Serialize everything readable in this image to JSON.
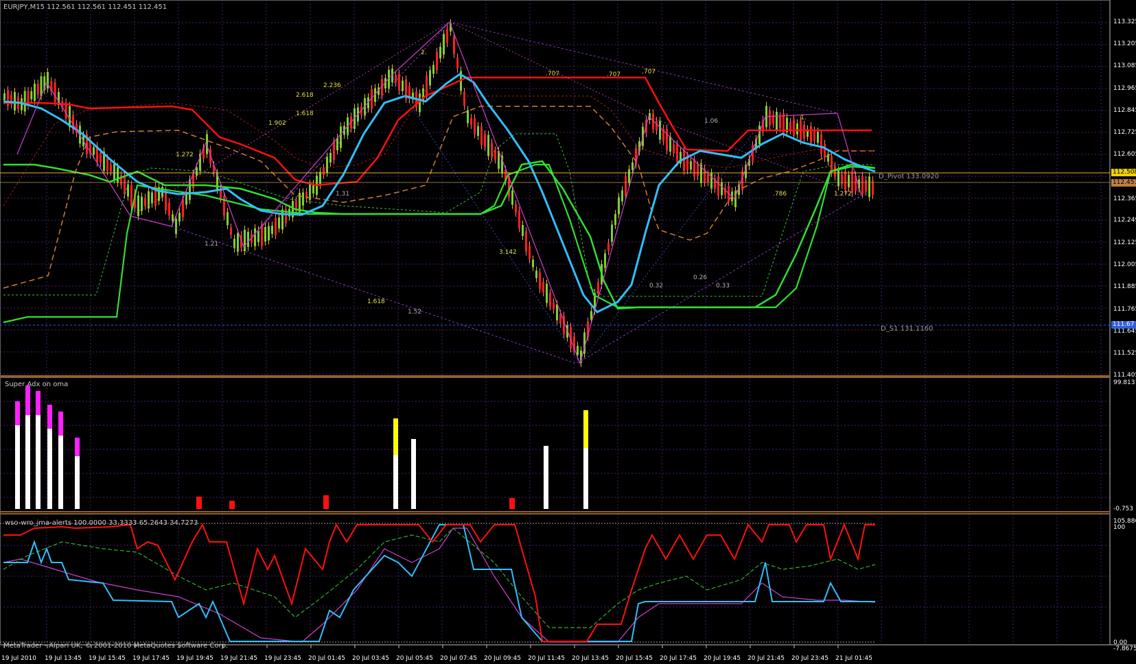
{
  "window": {
    "symbol_title": "EURJPY,M15  112.561 112.561 112.451 112.451",
    "copyright": "MetaTrader - Alpari UK, © 2001-2010 MetaQuotes Software Corp."
  },
  "colors": {
    "background": "#000000",
    "grid": "#4b1f6b",
    "separator": "#c08040",
    "bull_candle": "#7fd030",
    "bear_candle": "#ff2020",
    "wick_bull": "#e0c030",
    "cyan_ma": "#30c0ff",
    "red_line": "#ff1010",
    "green_line": "#30e030",
    "orange_dash": "#d0802a",
    "fib_magenta": "#d040d0",
    "fib_dotted": "#8040c0",
    "pivot_line": "#e8b040",
    "s1_line": "#3060e0"
  },
  "price_axis": {
    "labels": [
      "113.325",
      "113.205",
      "113.085",
      "112.965",
      "112.845",
      "112.725",
      "112.605",
      "112.365",
      "112.249",
      "112.125",
      "112.005",
      "111.885",
      "111.765",
      "111.645",
      "111.525",
      "111.405"
    ],
    "tag_bid": "112.508",
    "tag_last": "112.451",
    "tag_s1": "111.67"
  },
  "pivots": {
    "pivot": "D_Pivot 133.0920",
    "s1": "D_S1 131.1160"
  },
  "fib_labels": [
    {
      "text": "2.",
      "color": "#e0e040"
    },
    {
      "text": ".707",
      "color": "#e0e040"
    },
    {
      "text": ".707",
      "color": "#e0e040"
    },
    {
      "text": ".707",
      "color": "#e0e040"
    },
    {
      "text": "2.618",
      "color": "#e0e040"
    },
    {
      "text": "2.236",
      "color": "#e0e040"
    },
    {
      "text": "1.618",
      "color": "#e0e040"
    },
    {
      "text": "1.902",
      "color": "#e0e040"
    },
    {
      "text": "1.272",
      "color": "#e0e040"
    },
    {
      "text": "1.31",
      "color": "#b0b0b0"
    },
    {
      "text": "1.21",
      "color": "#b0b0b0"
    },
    {
      "text": "3.142",
      "color": "#e0e040"
    },
    {
      "text": "1.618",
      "color": "#e0e040"
    },
    {
      "text": "1.52",
      "color": "#b0b0b0"
    },
    {
      "text": "1.06",
      "color": "#b0b0b0"
    },
    {
      "text": "1.",
      "color": "#e0e040"
    },
    {
      "text": ".786",
      "color": "#e0e040"
    },
    {
      "text": "1.272",
      "color": "#e0e040"
    },
    {
      "text": "0.32",
      "color": "#b0b0b0"
    },
    {
      "text": "0.26",
      "color": "#b0b0b0"
    },
    {
      "text": "0.33",
      "color": "#b0b0b0"
    }
  ],
  "adx_pane": {
    "title": "Super Adx on oma",
    "max_label": "99.8131",
    "min_label": "-0.753"
  },
  "wso_pane": {
    "title": "wso-wro_jma-alerts 100.0000 33.3333 65.2643 34.7273",
    "max_label": "105.886",
    "label_100": "100",
    "label_zero": "0.00",
    "min_label": "-7.8675"
  },
  "time_axis": [
    "19 Jul 2010",
    "19 Jul 13:45",
    "19 Jul 15:45",
    "19 Jul 17:45",
    "19 Jul 19:45",
    "19 Jul 21:45",
    "19 Jul 23:45",
    "20 Jul 01:45",
    "20 Jul 03:45",
    "20 Jul 05:45",
    "20 Jul 07:45",
    "20 Jul 09:45",
    "20 Jul 11:45",
    "20 Jul 13:45",
    "20 Jul 15:45",
    "20 Jul 17:45",
    "20 Jul 19:45",
    "20 Jul 21:45",
    "20 Jul 23:45",
    "21 Jul 01:45"
  ]
}
